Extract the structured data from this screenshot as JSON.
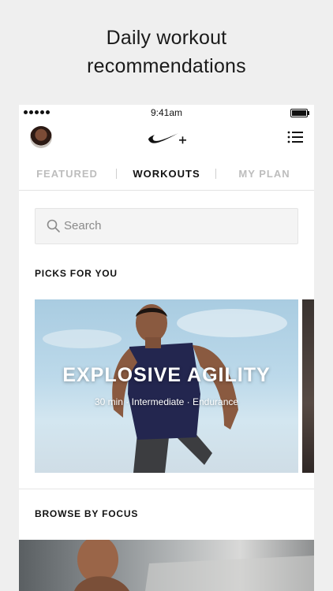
{
  "headline": {
    "line1": "Daily workout",
    "line2": "recommendations"
  },
  "status_bar": {
    "time": "9:41am"
  },
  "tabs": [
    {
      "label": "FEATURED"
    },
    {
      "label": "WORKOUTS"
    },
    {
      "label": "MY PLAN"
    }
  ],
  "active_tab": "WORKOUTS",
  "search": {
    "placeholder": "Search"
  },
  "sections": {
    "picks": "PICKS FOR YOU",
    "browse": "BROWSE BY FOCUS"
  },
  "featured_card": {
    "title": "EXPLOSIVE AGILITY",
    "meta": "30 min · Intermediate · Endurance"
  },
  "icons": {
    "logo": "nike-swoosh-plus-icon",
    "menu": "list-menu-icon",
    "search": "search-icon"
  }
}
